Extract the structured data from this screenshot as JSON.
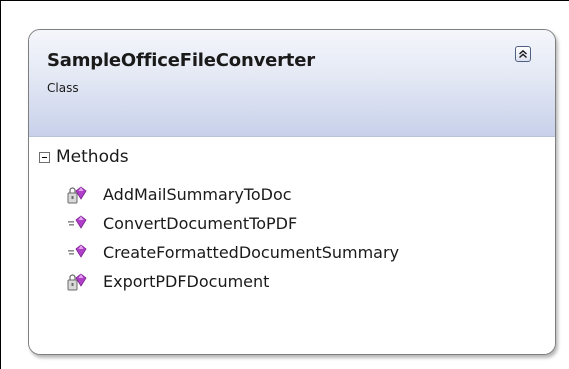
{
  "class_shape": {
    "name": "SampleOfficeFileConverter",
    "kind": "Class",
    "collapse_icon": "double-chevron-up-icon"
  },
  "methods_section": {
    "label": "Methods",
    "toggle_icon": "minus-box-icon",
    "items": [
      {
        "name": "AddMailSummaryToDoc",
        "icon": "protected-method-icon"
      },
      {
        "name": "ConvertDocumentToPDF",
        "icon": "public-method-icon"
      },
      {
        "name": "CreateFormattedDocumentSummary",
        "icon": "public-method-icon"
      },
      {
        "name": "ExportPDFDocument",
        "icon": "protected-method-icon"
      }
    ]
  },
  "colors": {
    "header_gradient_top": "#f4f6fb",
    "header_gradient_bottom": "#c8d1ea",
    "method_gem": "#b03fc8",
    "border": "#7f7f7f"
  }
}
